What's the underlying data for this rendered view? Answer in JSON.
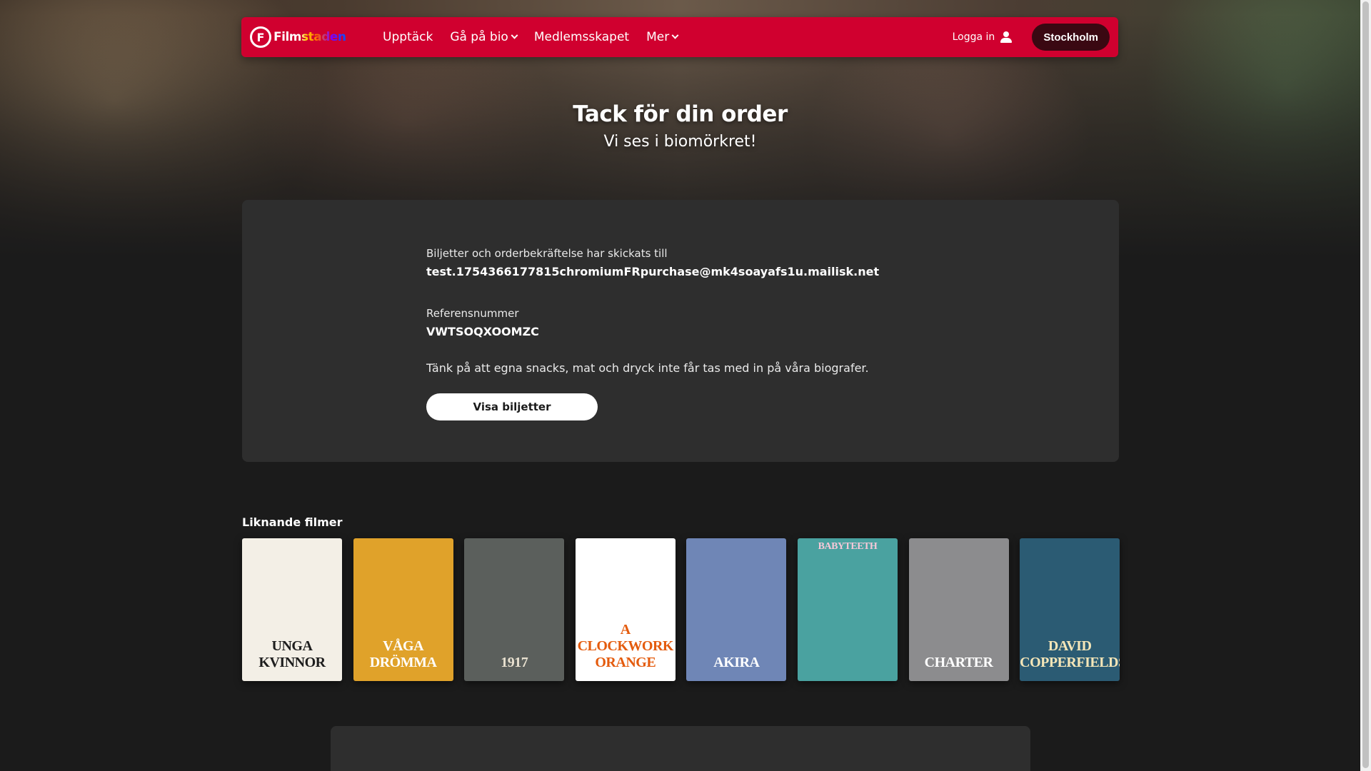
{
  "nav": {
    "logo_text": "Filmstaden",
    "links": [
      {
        "label": "Upptäck",
        "has_chevron": false
      },
      {
        "label": "Gå på bio",
        "has_chevron": true
      },
      {
        "label": "Medlemsskapet",
        "has_chevron": false
      },
      {
        "label": "Mer",
        "has_chevron": true
      }
    ],
    "login_label": "Logga in",
    "city_label": "Stockholm"
  },
  "hero": {
    "title": "Tack för din order",
    "subtitle": "Vi ses i biomörkret!"
  },
  "order": {
    "sent_to_label": "Biljetter och orderbekräftelse har skickats till",
    "email": "test.1754366177815chromiumFRpurchase@mk4soayafs1u.mailisk.net",
    "reference_label": "Referensnummer",
    "reference_number": "VWTSOQXOOMZC",
    "snacks_notice": "Tänk på att egna snacks, mat och dryck inte får tas med in på våra biografer.",
    "show_tickets_label": "Visa biljetter"
  },
  "similar": {
    "title": "Liknande filmer",
    "posters": [
      {
        "text": "UNGA KVINNOR",
        "bg": "#f3efe6",
        "fg": "#1d1d1d",
        "pos": "bottom"
      },
      {
        "text": "VÅGA DRÖMMA",
        "bg": "#e0a22a",
        "fg": "#ffffff",
        "pos": "bottom"
      },
      {
        "text": "1917",
        "bg": "#5b5f5c",
        "fg": "#e9e1d0",
        "pos": "bottom"
      },
      {
        "text": "A CLOCKWORK ORANGE",
        "bg": "#ffffff",
        "fg": "#e45b0d",
        "pos": "bottom"
      },
      {
        "text": "AKIRA",
        "bg": "#6f86b6",
        "fg": "#ffffff",
        "pos": "bottom"
      },
      {
        "text": "BABYTEETH",
        "bg": "#4aa2a0",
        "fg": "#f6c8d8",
        "pos": "top"
      },
      {
        "text": "CHARTER",
        "bg": "#8c8c8e",
        "fg": "#ffffff",
        "pos": "bottom"
      },
      {
        "text": "DAVID COPPERFIELDS",
        "bg": "#2b5b73",
        "fg": "#f5e6b8",
        "pos": "bottom"
      }
    ]
  }
}
